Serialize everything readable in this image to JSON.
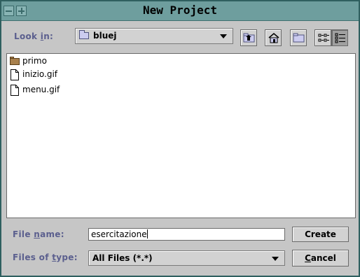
{
  "window": {
    "title": "New Project"
  },
  "look_in": {
    "label_pre": "Look ",
    "label_key": "i",
    "label_post": "n:",
    "value": "bluej"
  },
  "toolbar": {
    "up_icon": "folder-up-icon",
    "home_icon": "home-icon",
    "new_folder_icon": "new-folder-icon",
    "list_view_icon": "list-view-icon",
    "details_view_icon": "details-view-icon"
  },
  "files": [
    {
      "name": "primo",
      "type": "folder"
    },
    {
      "name": "inizio.gif",
      "type": "file"
    },
    {
      "name": "menu.gif",
      "type": "file"
    }
  ],
  "file_name": {
    "label_pre": "File ",
    "label_key": "n",
    "label_post": "ame:",
    "value": "esercitazione"
  },
  "file_type": {
    "label_pre": "Files of ",
    "label_key": "t",
    "label_post": "ype:",
    "value": "All Files (*.*)"
  },
  "buttons": {
    "create": "Create",
    "cancel_key": "C",
    "cancel_rest": "ancel"
  }
}
